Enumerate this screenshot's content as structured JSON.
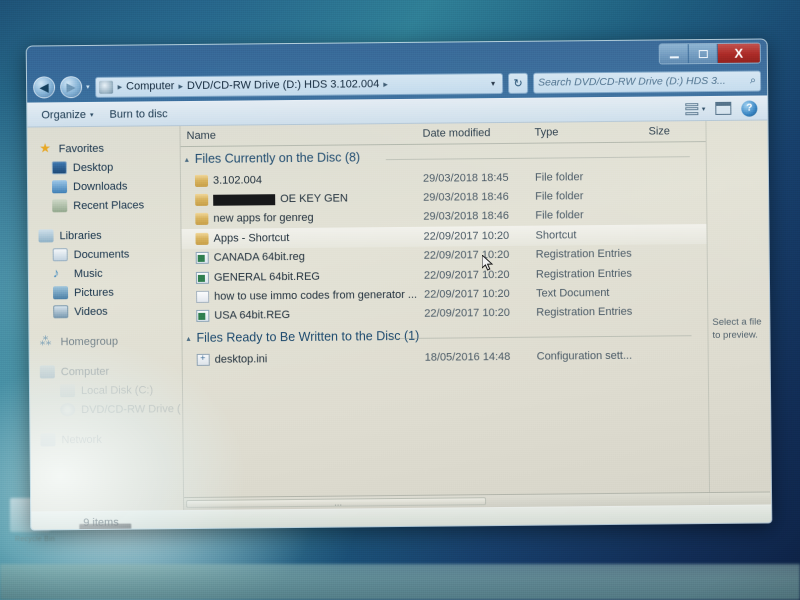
{
  "window": {
    "title": "",
    "controls": {
      "minimize": "Minimize",
      "maximize": "Maximize",
      "close": "X"
    }
  },
  "address_bar": {
    "back_label": "Back",
    "forward_label": "Forward",
    "history_caret": "▾",
    "crumbs": [
      "Computer",
      "DVD/CD-RW Drive (D:) HDS 3.102.004"
    ],
    "separator": "▸",
    "trailing_separator": "▸",
    "dropdown": "▾",
    "refresh": "↻"
  },
  "search": {
    "placeholder": "Search DVD/CD-RW Drive (D:) HDS 3...",
    "value": "",
    "icon": "search-icon"
  },
  "command_bar": {
    "organize": "Organize",
    "organize_caret": "▾",
    "burn": "Burn to disc",
    "view_caret": "▾",
    "help": "?"
  },
  "nav_pane": {
    "sections": [
      {
        "label": "Favorites",
        "icon": "star-icon",
        "items": [
          {
            "label": "Desktop",
            "icon": "desktop-icon"
          },
          {
            "label": "Downloads",
            "icon": "downloads-icon"
          },
          {
            "label": "Recent Places",
            "icon": "recent-places-icon"
          }
        ]
      },
      {
        "label": "Libraries",
        "icon": "libraries-icon",
        "items": [
          {
            "label": "Documents",
            "icon": "documents-icon"
          },
          {
            "label": "Music",
            "icon": "music-icon"
          },
          {
            "label": "Pictures",
            "icon": "pictures-icon"
          },
          {
            "label": "Videos",
            "icon": "videos-icon"
          }
        ]
      },
      {
        "label": "Homegroup",
        "icon": "homegroup-icon",
        "items": []
      },
      {
        "label": "Computer",
        "icon": "computer-icon",
        "items": [
          {
            "label": "Local Disk (C:)",
            "icon": "disk-icon"
          },
          {
            "label": "DVD/CD-RW Drive (",
            "icon": "dvd-drive-icon"
          }
        ]
      },
      {
        "label": "Network",
        "icon": "network-icon",
        "items": []
      }
    ]
  },
  "columns": {
    "name": "Name",
    "date_modified": "Date modified",
    "type": "Type",
    "size": "Size"
  },
  "groups": [
    {
      "header": "Files Currently on the Disc (8)",
      "expander": "▴",
      "rows": [
        {
          "name": "3.102.004",
          "redacted": false,
          "date": "29/03/2018 18:45",
          "type": "File folder",
          "size": "",
          "icon": "folder-icon"
        },
        {
          "name": "OE KEY GEN",
          "redacted": true,
          "date": "29/03/2018 18:46",
          "type": "File folder",
          "size": "",
          "icon": "folder-icon"
        },
        {
          "name": "new apps for genreg",
          "redacted": false,
          "date": "29/03/2018 18:46",
          "type": "File folder",
          "size": "",
          "icon": "folder-icon"
        },
        {
          "name": "Apps - Shortcut",
          "redacted": false,
          "date": "22/09/2017 10:20",
          "type": "Shortcut",
          "size": "",
          "icon": "folder-icon",
          "hover": true
        },
        {
          "name": "CANADA 64bit.reg",
          "redacted": false,
          "date": "22/09/2017 10:20",
          "type": "Registration Entries",
          "size": "",
          "icon": "registry-file-icon"
        },
        {
          "name": "GENERAL 64bit.REG",
          "redacted": false,
          "date": "22/09/2017 10:20",
          "type": "Registration Entries",
          "size": "",
          "icon": "registry-file-icon"
        },
        {
          "name": "how to use immo codes from generator ...",
          "redacted": false,
          "date": "22/09/2017 10:20",
          "type": "Text Document",
          "size": "",
          "icon": "text-file-icon"
        },
        {
          "name": "USA 64bit.REG",
          "redacted": false,
          "date": "22/09/2017 10:20",
          "type": "Registration Entries",
          "size": "",
          "icon": "registry-file-icon"
        }
      ]
    },
    {
      "header": "Files Ready to Be Written to the Disc (1)",
      "expander": "▴",
      "rows": [
        {
          "name": "desktop.ini",
          "redacted": false,
          "date": "18/05/2016 14:48",
          "type": "Configuration sett...",
          "size": "",
          "icon": "ini-file-icon"
        }
      ]
    }
  ],
  "preview_pane": {
    "text": "Select a file to preview."
  },
  "status_bar": {
    "items_count": "9 items"
  },
  "desktop": {
    "icon_label": "Recycle Bin"
  },
  "colors": {
    "accent": "#2f7fc0",
    "close_button": "#a8201c",
    "folder": "#d9b45f",
    "group_header_text": "#1d4a6e",
    "desktop_gradient_start": "#2f7f96",
    "desktop_gradient_end": "#0d2246"
  }
}
